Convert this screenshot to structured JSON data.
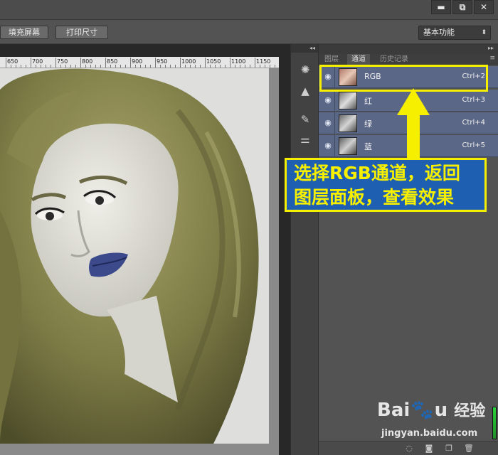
{
  "window_controls": {
    "minimize": "▬",
    "restore": "⧉",
    "close": "✕"
  },
  "options_bar": {
    "fill_screen_label": "填充屏幕",
    "print_size_label": "打印尺寸",
    "workspace_value": "基本功能"
  },
  "ruler": {
    "labels": [
      "650",
      "700",
      "750",
      "800",
      "850",
      "900",
      "950",
      "1000",
      "1050",
      "1100",
      "1150"
    ]
  },
  "panel": {
    "collapse_glyph": "◂◂",
    "tabs": [
      "图层",
      "通道",
      "历史记录"
    ],
    "active_tab": "通道",
    "channels": [
      {
        "name": "RGB",
        "shortcut": "Ctrl+2"
      },
      {
        "name": "红",
        "shortcut": "Ctrl+3"
      },
      {
        "name": "绿",
        "shortcut": "Ctrl+4"
      },
      {
        "name": "蓝",
        "shortcut": "Ctrl+5"
      }
    ]
  },
  "annotation": {
    "line1": "选择RGB通道，返回",
    "line2": "图层面板，查看效果"
  },
  "watermark": {
    "logo": "Bai du 经验",
    "url": "jingyan.baidu.com"
  }
}
